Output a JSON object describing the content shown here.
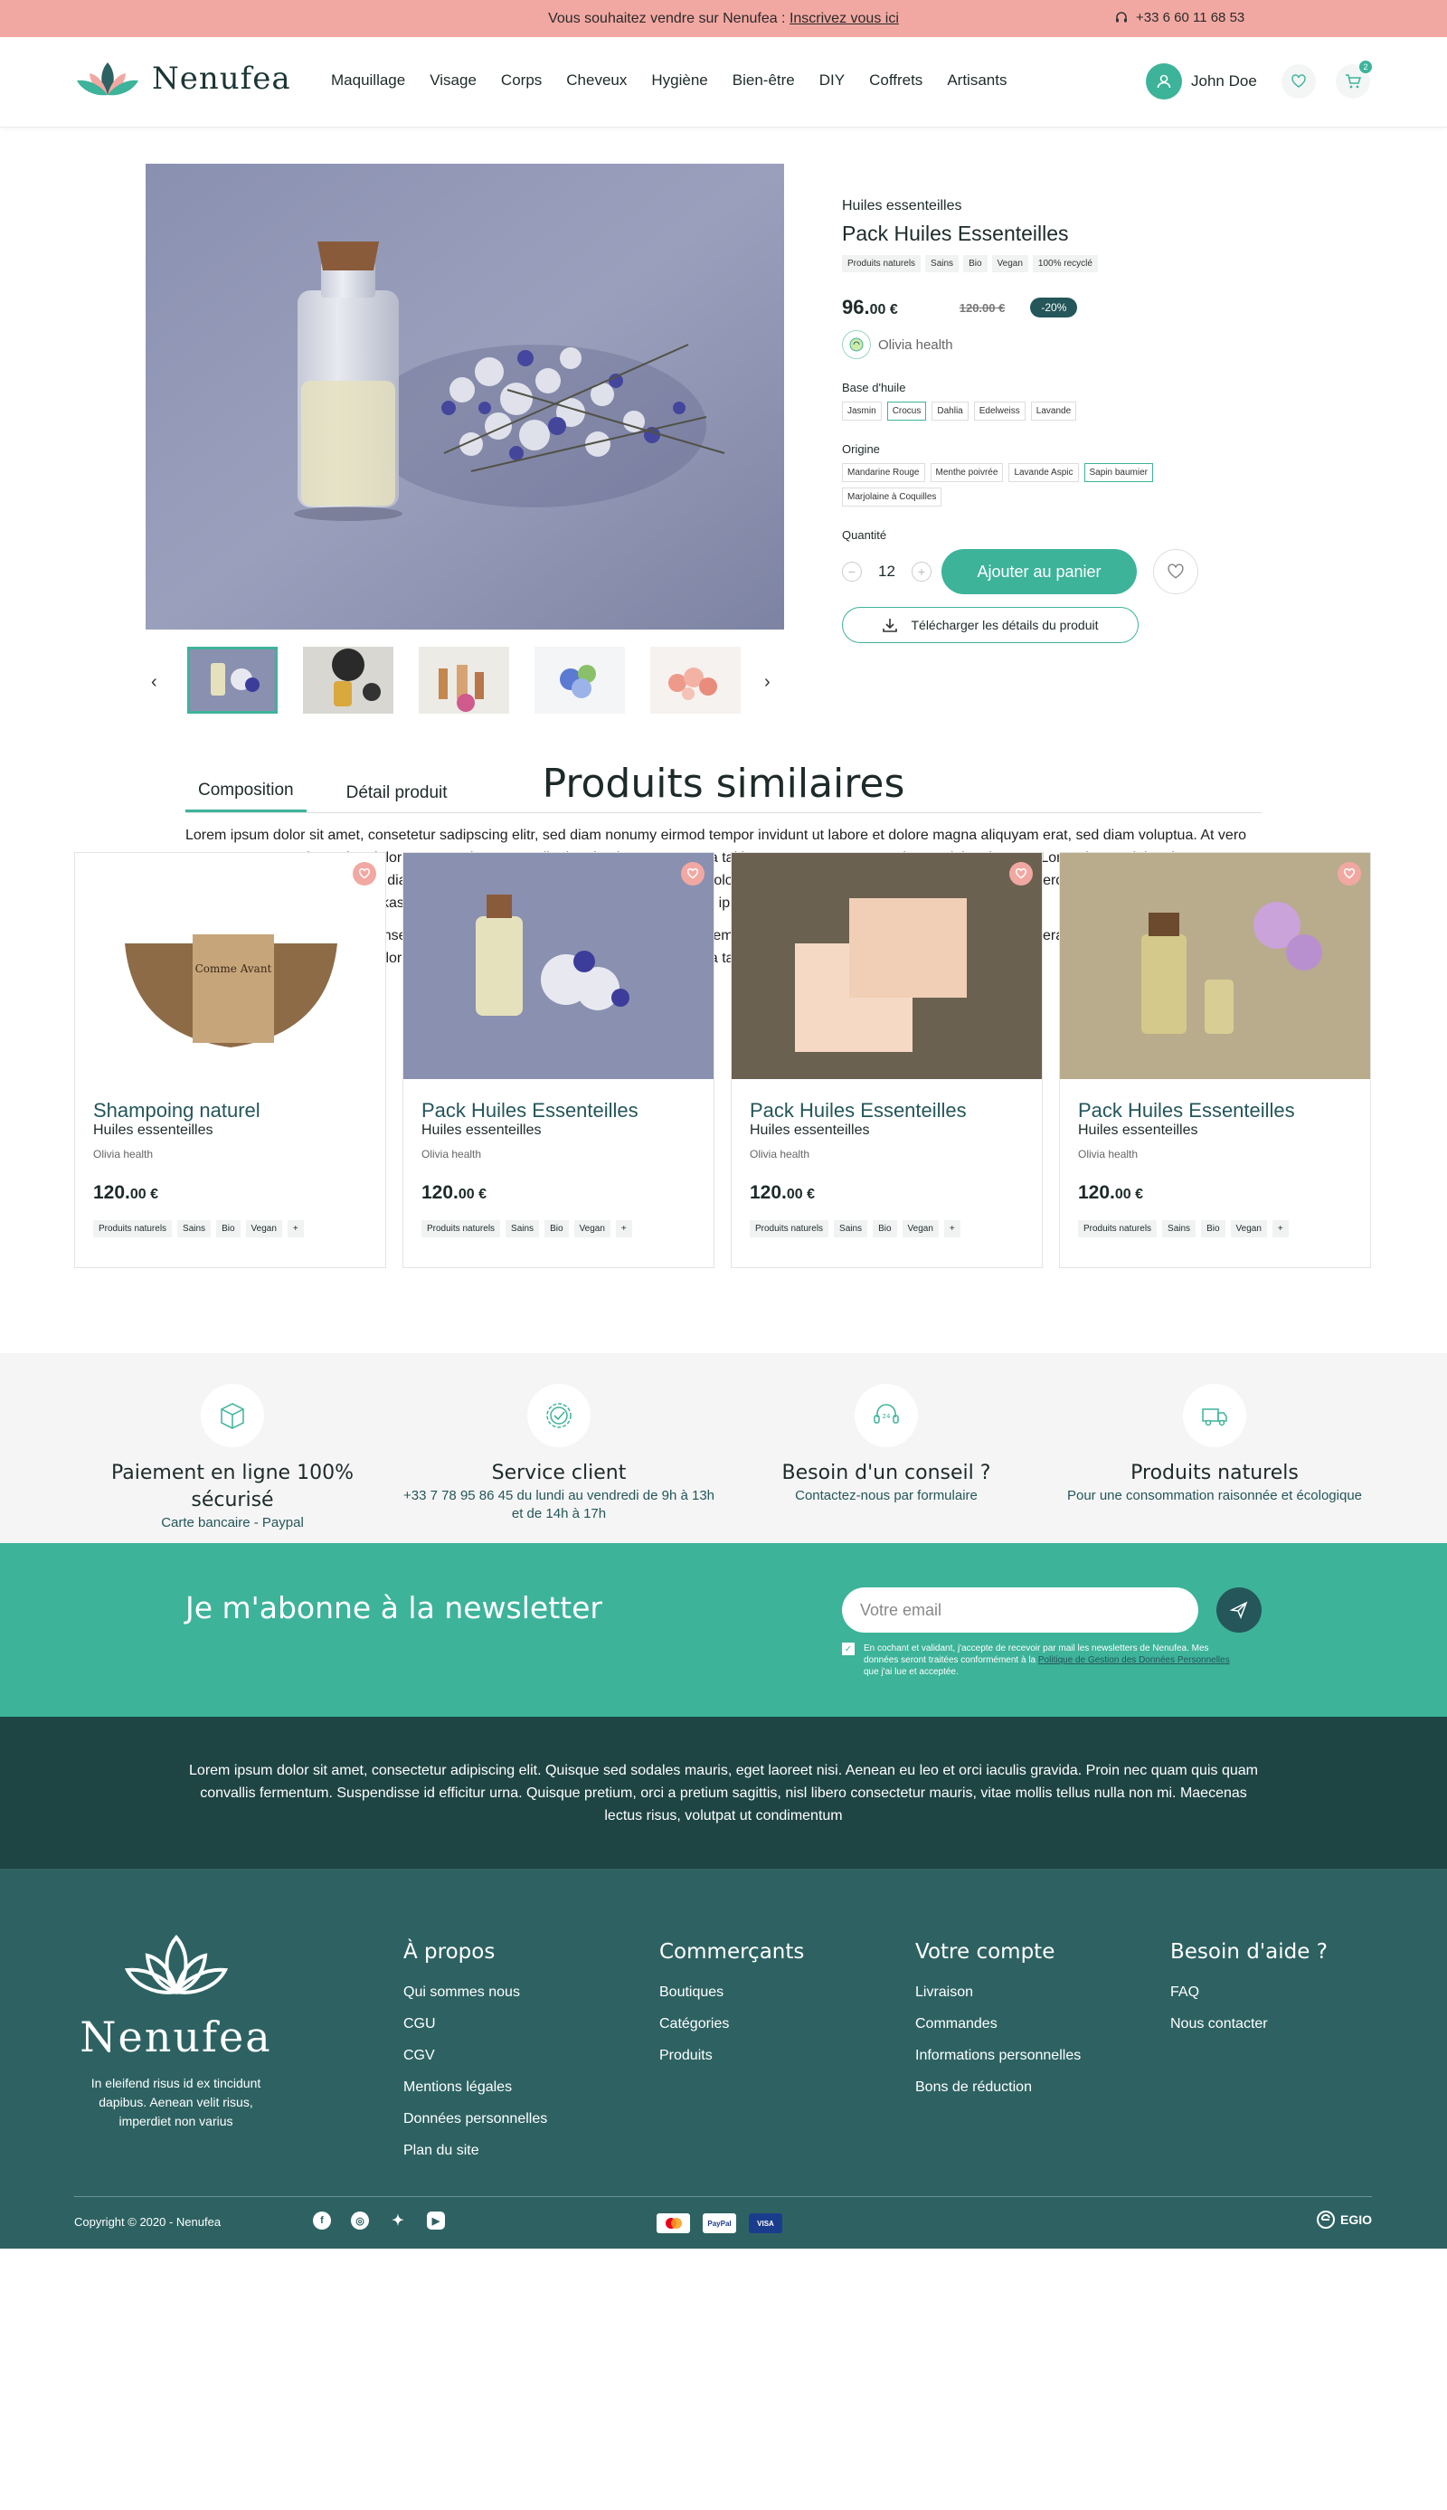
{
  "topbar": {
    "sell_text": "Vous souhaitez vendre sur Nenufea :",
    "sell_link": "Inscrivez vous ici",
    "phone": "+33 6 60 11 68 53"
  },
  "header": {
    "logo_text": "Nenufea",
    "nav": [
      "Maquillage",
      "Visage",
      "Corps",
      "Cheveux",
      "Hygiène",
      "Bien-être",
      "DIY",
      "Coffrets",
      "Artisants"
    ],
    "user_name": "John Doe",
    "cart_count": "2"
  },
  "product": {
    "category": "Huiles essenteilles",
    "title": "Pack Huiles Essenteilles",
    "tags": [
      "Produits naturels",
      "Sains",
      "Bio",
      "Vegan",
      "100% recyclé"
    ],
    "price_int": "96.",
    "price_dec": "00 €",
    "old_price": "120.00 €",
    "discount": "-20%",
    "seller": "Olivia health",
    "base_label": "Base d'huile",
    "base_options": [
      "Jasmin",
      "Crocus",
      "Dahlia",
      "Edelweiss",
      "Lavande"
    ],
    "base_selected": "Crocus",
    "origin_label": "Origine",
    "origin_options": [
      "Mandarine Rouge",
      "Menthe poivrée",
      "Lavande Aspic",
      "Sapin baumier",
      "Marjolaine à Coquilles"
    ],
    "origin_selected": "Sapin baumier",
    "quantity_label": "Quantité",
    "quantity": "12",
    "add_to_cart": "Ajouter au panier",
    "download": "Télécharger les détails du produit"
  },
  "tabs": {
    "items": [
      "Composition",
      "Détail produit"
    ],
    "active": "Composition",
    "paragraphs": [
      "Lorem ipsum dolor sit amet, consetetur sadipscing elitr, sed diam nonumy eirmod tempor invidunt ut labore et dolore magna aliquyam erat, sed diam voluptua. At vero eos et accusam et justo duo dolores et ea rebum. Stet clita kasd gubergren, no sea takimata sanctus est Lorem ipsum dolor sit amet. Lorem ipsum dolor sit amet, consetetur sadipscing elitr, sed diam nonumy eirmod tempor invidunt ut labore et dolore magna aliquyam erat, sed diam voluptua. At vero eos et accusam et justo duo dolores et ea rebum. Stet clita kasd gubergren, no sea takimata sanctus est Lorem ipsum dolor sit amet.",
      "Lorem ipsum dolor sit amet, consetetur sadipscing elitr, sed diam nonumy eirmod tempor invidunt ut labore et dolore magna aliquyam erat, sed diam voluptua. At vero eos et accusam et justo duo dolores et ea rebum. Stet clita kasd gubergren, no sea takimata sanctus est Lorem"
    ]
  },
  "similar": {
    "title": "Produits similaires",
    "cards": [
      {
        "name": "Shampoing naturel",
        "category": "Huiles essenteilles",
        "seller": "Olivia health",
        "price_int": "120.",
        "price_dec": "00 €",
        "tags": [
          "Produits naturels",
          "Sains",
          "Bio",
          "Vegan",
          "+"
        ]
      },
      {
        "name": "Pack Huiles Essenteilles",
        "category": "Huiles essenteilles",
        "seller": "Olivia health",
        "price_int": "120.",
        "price_dec": "00 €",
        "tags": [
          "Produits naturels",
          "Sains",
          "Bio",
          "Vegan",
          "+"
        ]
      },
      {
        "name": "Pack Huiles Essenteilles",
        "category": "Huiles essenteilles",
        "seller": "Olivia health",
        "price_int": "120.",
        "price_dec": "00 €",
        "tags": [
          "Produits naturels",
          "Sains",
          "Bio",
          "Vegan",
          "+"
        ]
      },
      {
        "name": "Pack Huiles Essenteilles",
        "category": "Huiles essenteilles",
        "seller": "Olivia health",
        "price_int": "120.",
        "price_dec": "00 €",
        "tags": [
          "Produits naturels",
          "Sains",
          "Bio",
          "Vegan",
          "+"
        ]
      }
    ],
    "soap_label": "Comme Avant"
  },
  "features": [
    {
      "title": "Paiement en ligne 100% sécurisé",
      "sub": "Carte bancaire - Paypal",
      "icon": "box-icon"
    },
    {
      "title": "Service client",
      "sub": "+33 7 78 95 86 45 du lundi au vendredi de 9h à 13h et de 14h à 17h",
      "icon": "badge-check-icon"
    },
    {
      "title": "Besoin d'un conseil ?",
      "sub": "Contactez-nous par formulaire",
      "icon": "headset-24-icon"
    },
    {
      "title": "Produits naturels",
      "sub": "Pour une consommation raisonnée et écologique",
      "icon": "truck-icon"
    }
  ],
  "newsletter": {
    "title": "Je m'abonne à la newsletter",
    "placeholder": "Votre email",
    "consent_1": "En cochant et validant, j'accepte de recevoir par mail les newsletters de Nenufea. Mes données seront traitées conformément à la ",
    "consent_link": "Politique de Gestion des Données Personnelles",
    "consent_2": " que j'ai lue et acceptée."
  },
  "about": "Lorem ipsum dolor sit amet, consectetur adipiscing elit. Quisque sed sodales mauris, eget laoreet nisi. Aenean eu leo et orci iaculis gravida. Proin nec quam quis quam convallis fermentum. Suspendisse id efficitur urna. Quisque pretium, orci a pretium sagittis, nisl libero consectetur mauris, vitae mollis tellus nulla non mi. Maecenas lectus risus, volutpat ut condimentum",
  "footer": {
    "logo_text": "Nenufea",
    "tagline": "In eleifend risus id ex tincidunt dapibus. Aenean velit risus, imperdiet non varius",
    "columns": [
      {
        "title": "À propos",
        "links": [
          "Qui sommes nous",
          "CGU",
          "CGV",
          "Mentions légales",
          "Données personnelles",
          "Plan du site"
        ]
      },
      {
        "title": "Commerçants",
        "links": [
          "Boutiques",
          "Catégories",
          "Produits"
        ]
      },
      {
        "title": "Votre compte",
        "links": [
          "Livraison",
          "Commandes",
          "Informations personnelles",
          "Bons de réduction"
        ]
      },
      {
        "title": "Besoin d'aide ?",
        "links": [
          "FAQ",
          "Nous contacter"
        ]
      }
    ],
    "copyright": "Copyright © 2020 - Nenufea",
    "social": [
      "facebook-icon",
      "instagram-icon",
      "twitter-icon",
      "youtube-icon"
    ],
    "payments": [
      "mastercard-icon",
      "PayPal",
      "VISA"
    ],
    "agency": "EGIO"
  },
  "colors": {
    "accent": "#3db39a",
    "dark_teal": "#24565a",
    "pink": "#f2a8a2",
    "footer_bg": "#2e6262",
    "about_bg": "#1f4444"
  }
}
